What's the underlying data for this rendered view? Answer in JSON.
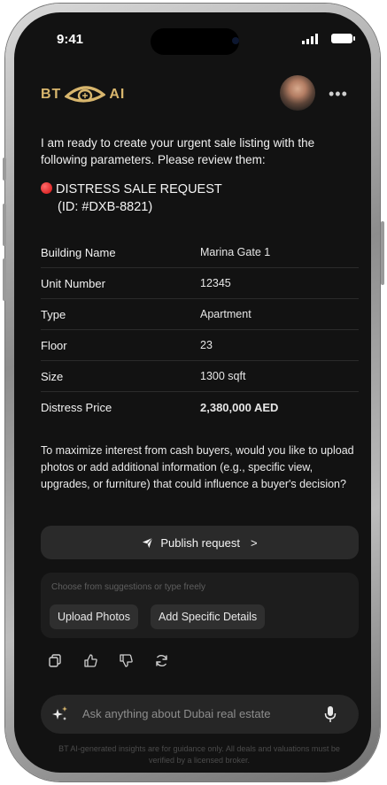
{
  "status_bar": {
    "time": "9:41"
  },
  "header": {
    "logo_left": "BT",
    "logo_right": "AI"
  },
  "message": {
    "intro": "I am ready to create your urgent sale listing with the following parameters. Please review them:",
    "title": "DISTRESS SALE REQUEST",
    "request_id": "(ID: #DXB-8821)",
    "details": [
      {
        "label": "Building Name",
        "value": "Marina Gate 1"
      },
      {
        "label": "Unit Number",
        "value": "12345"
      },
      {
        "label": "Type",
        "value": "Apartment"
      },
      {
        "label": "Floor",
        "value": "23"
      },
      {
        "label": "Size",
        "value": "1300 sqft"
      },
      {
        "label": "Distress Price",
        "value": "2,380,000 AED"
      }
    ],
    "question": "To maximize interest from cash buyers, would you like to upload photos or add additional information (e.g., specific view, upgrades, or furniture) that could influence a buyer's decision?"
  },
  "publish": {
    "label": "Publish request",
    "arrow": ">"
  },
  "suggestions": {
    "hint": "Choose from suggestions or type freely",
    "chips": [
      "Upload Photos",
      "Add Specific Details"
    ]
  },
  "actions": [
    "copy-icon",
    "thumbs-up-icon",
    "thumbs-down-icon",
    "refresh-icon"
  ],
  "input": {
    "placeholder": "Ask anything about Dubai real estate"
  },
  "disclaimer": "BT AI-generated insights are for guidance only. All deals and valuations must be verified by a licensed broker.",
  "colors": {
    "brand_gold": "#d8b66d",
    "status_red": "#d10f0f",
    "background": "#121212"
  }
}
